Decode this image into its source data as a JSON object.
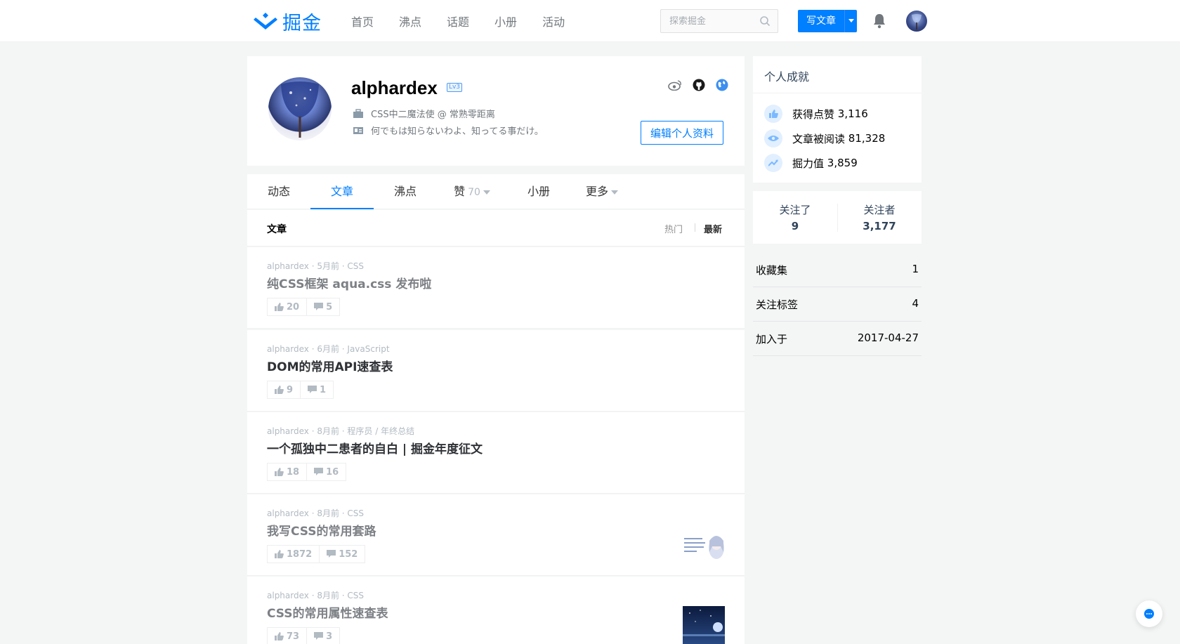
{
  "header": {
    "logo_text": "掘金",
    "nav": [
      "首页",
      "沸点",
      "话题",
      "小册",
      "活动"
    ],
    "search_placeholder": "探索掘金",
    "write_label": "写文章",
    "brand_color": "#007fff"
  },
  "profile": {
    "username": "alphardex",
    "level": "Lv3",
    "job": "CSS中二魔法使 @ 常熟零距离",
    "bio": "何でもは知らないわよ、知ってる事だけ。",
    "edit_label": "编辑个人资料",
    "social_icons": [
      "weibo-icon",
      "github-icon",
      "globe-icon"
    ]
  },
  "tabs": [
    {
      "label": "动态"
    },
    {
      "label": "文章",
      "active": true
    },
    {
      "label": "沸点"
    },
    {
      "label": "赞",
      "count": "70"
    },
    {
      "label": "小册"
    },
    {
      "label": "更多"
    }
  ],
  "list": {
    "title": "文章",
    "sort_hot": "热门",
    "sort_new": "最新"
  },
  "articles": [
    {
      "meta": "alphardex · 5月前 · CSS",
      "title": "纯CSS框架 aqua.css 发布啦",
      "likes": "20",
      "comments": "5"
    },
    {
      "meta": "alphardex · 6月前 · JavaScript",
      "title": "DOM的常用API速查表",
      "likes": "9",
      "comments": "1"
    },
    {
      "meta": "alphardex · 8月前 · 程序员 / 年终总结",
      "title": "一个孤独中二患者的自白 | 掘金年度征文",
      "likes": "18",
      "comments": "16"
    },
    {
      "meta": "alphardex · 8月前 · CSS",
      "title": "我写CSS的常用套路",
      "likes": "1872",
      "comments": "152"
    },
    {
      "meta": "alphardex · 8月前 · CSS",
      "title": "CSS的常用属性速查表",
      "likes": "73",
      "comments": "3"
    }
  ],
  "achievements": {
    "title": "个人成就",
    "likes_label": "获得点赞",
    "likes": "3,116",
    "reads_label": "文章被阅读",
    "reads": "81,328",
    "power_label": "掘力值",
    "power": "3,859"
  },
  "follow": {
    "following_label": "关注了",
    "following": "9",
    "followers_label": "关注者",
    "followers": "3,177"
  },
  "stats": [
    {
      "label": "收藏集",
      "value": "1"
    },
    {
      "label": "关注标签",
      "value": "4"
    },
    {
      "label": "加入于",
      "value": "2017-04-27"
    }
  ]
}
